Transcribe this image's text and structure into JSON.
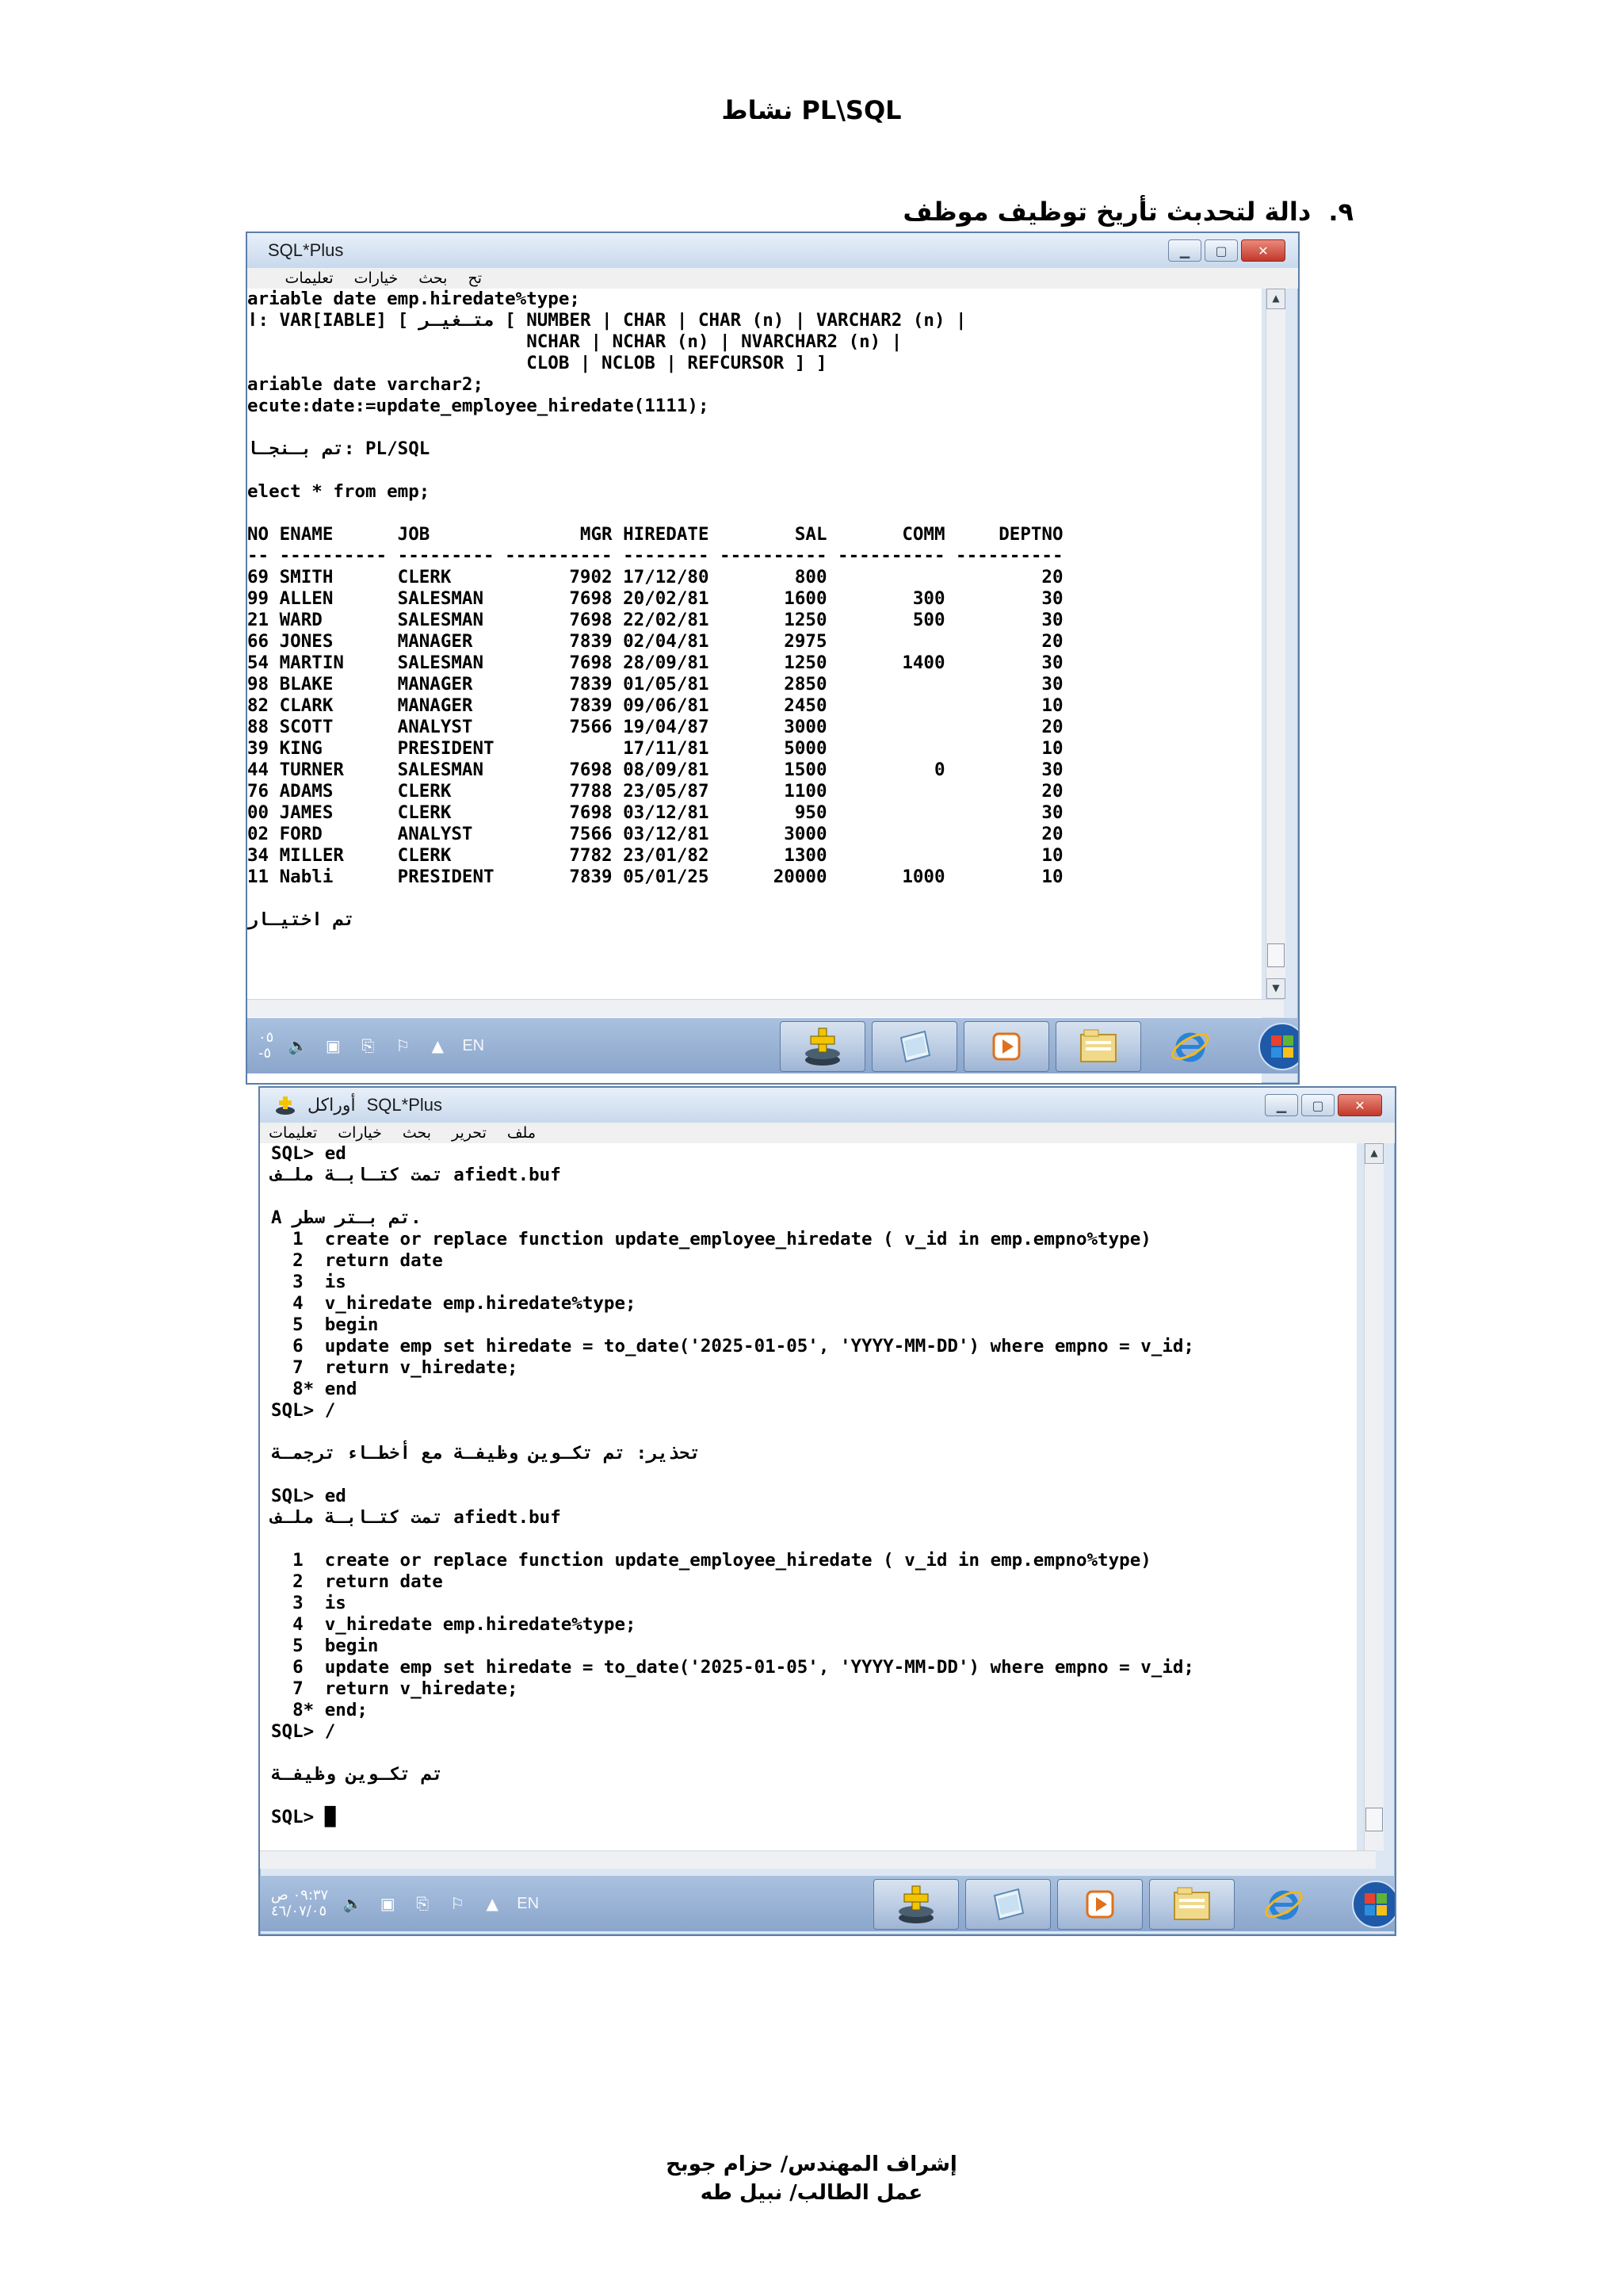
{
  "page": {
    "title": "نشاط PL\\SQL",
    "heading_number": "٩.",
    "heading_text": "دالة لتحدبث تأريخ توظيف موظف",
    "footer_line1": "إشراف المهندس/ حزام جوبح",
    "footer_line2": "عمل الطالب/ نبيل طه"
  },
  "window1": {
    "title": "SQL*Plus",
    "menu": [
      "تح",
      "بحث",
      "خيارات",
      "تعليمات"
    ],
    "lines": [
      "ariable date emp.hiredate%type;",
      "ا: VAR[IABLE] [ متـغيـر [ NUMBER | CHAR | CHAR (n) | VARCHAR2 (n) |",
      "                          NCHAR | NCHAR (n) | NVARCHAR2 (n) |",
      "                          CLOB | NCLOB | REFCURSOR ] ]",
      "ariable date varchar2;",
      "ecute:date:=update_employee_hiredate(1111);",
      "",
      "تم بـنجـا: PL/SQL",
      "",
      "elect * from emp;",
      "",
      "NO ENAME      JOB              MGR HIREDATE        SAL       COMM     DEPTNO",
      "-- ---------- --------- ---------- -------- ---------- ---------- ----------",
      "69 SMITH      CLERK           7902 17/12/80        800                    20",
      "99 ALLEN      SALESMAN        7698 20/02/81       1600        300         30",
      "21 WARD       SALESMAN        7698 22/02/81       1250        500         30",
      "66 JONES      MANAGER         7839 02/04/81       2975                    20",
      "54 MARTIN     SALESMAN        7698 28/09/81       1250       1400         30",
      "98 BLAKE      MANAGER         7839 01/05/81       2850                    30",
      "82 CLARK      MANAGER         7839 09/06/81       2450                    10",
      "88 SCOTT      ANALYST         7566 19/04/87       3000                    20",
      "39 KING       PRESIDENT            17/11/81       5000                    10",
      "44 TURNER     SALESMAN        7698 08/09/81       1500          0         30",
      "76 ADAMS      CLERK           7788 23/05/87       1100                    20",
      "00 JAMES      CLERK           7698 03/12/81        950                    30",
      "02 FORD       ANALYST         7566 03/12/81       3000                    20",
      "34 MILLER     CLERK           7782 23/01/82       1300                    10",
      "11 Nabli      PRESIDENT       7839 05/01/25      20000       1000         10",
      "",
      "تم اختيـار"
    ],
    "tray": {
      "clock1": "٠٥",
      "clock2": "-٥",
      "lang": "EN"
    }
  },
  "window2": {
    "title": "SQL*Plus",
    "title_prefix": "أوراكل",
    "menu": [
      "ملف",
      "تحرير",
      "بحث",
      "خيارات",
      "تعليمات"
    ],
    "lines": [
      "SQL> ed",
      "تمت كتـابـة ملـف afiedt.buf",
      "",
      "A تم بـتر سطر.",
      "  1  create or replace function update_employee_hiredate ( v_id in emp.empno%type)",
      "  2  return date",
      "  3  is",
      "  4  v_hiredate emp.hiredate%type;",
      "  5  begin",
      "  6  update emp set hiredate = to_date('2025-01-05', 'YYYY-MM-DD') where empno = v_id;",
      "  7  return v_hiredate;",
      "  8* end",
      "SQL> /",
      "",
      "تحذير: تم تكـوين وظيفـة مع أخطـاء ترجمـة",
      "",
      "SQL> ed",
      "تمت كتـابـة ملـف afiedt.buf",
      "",
      "  1  create or replace function update_employee_hiredate ( v_id in emp.empno%type)",
      "  2  return date",
      "  3  is",
      "  4  v_hiredate emp.hiredate%type;",
      "  5  begin",
      "  6  update emp set hiredate = to_date('2025-01-05', 'YYYY-MM-DD') where empno = v_id;",
      "  7  return v_hiredate;",
      "  8* end;",
      "SQL> /",
      "",
      "تم تكـوين وظيفـة",
      "",
      "SQL> █"
    ],
    "tray": {
      "clock1": "٠٩:٣٧ ص",
      "clock2": "٤٦/٠٧/٠٥",
      "lang": "EN"
    }
  },
  "icons": [
    "tray-volume-icon",
    "tray-network-icon",
    "tray-device-icon",
    "tray-flag-icon",
    "tray-arrow-icon",
    "oracle-install-icon",
    "notepad-icon",
    "media-player-icon",
    "explorer-folder-icon",
    "internet-explorer-icon",
    "windows-start-icon"
  ]
}
